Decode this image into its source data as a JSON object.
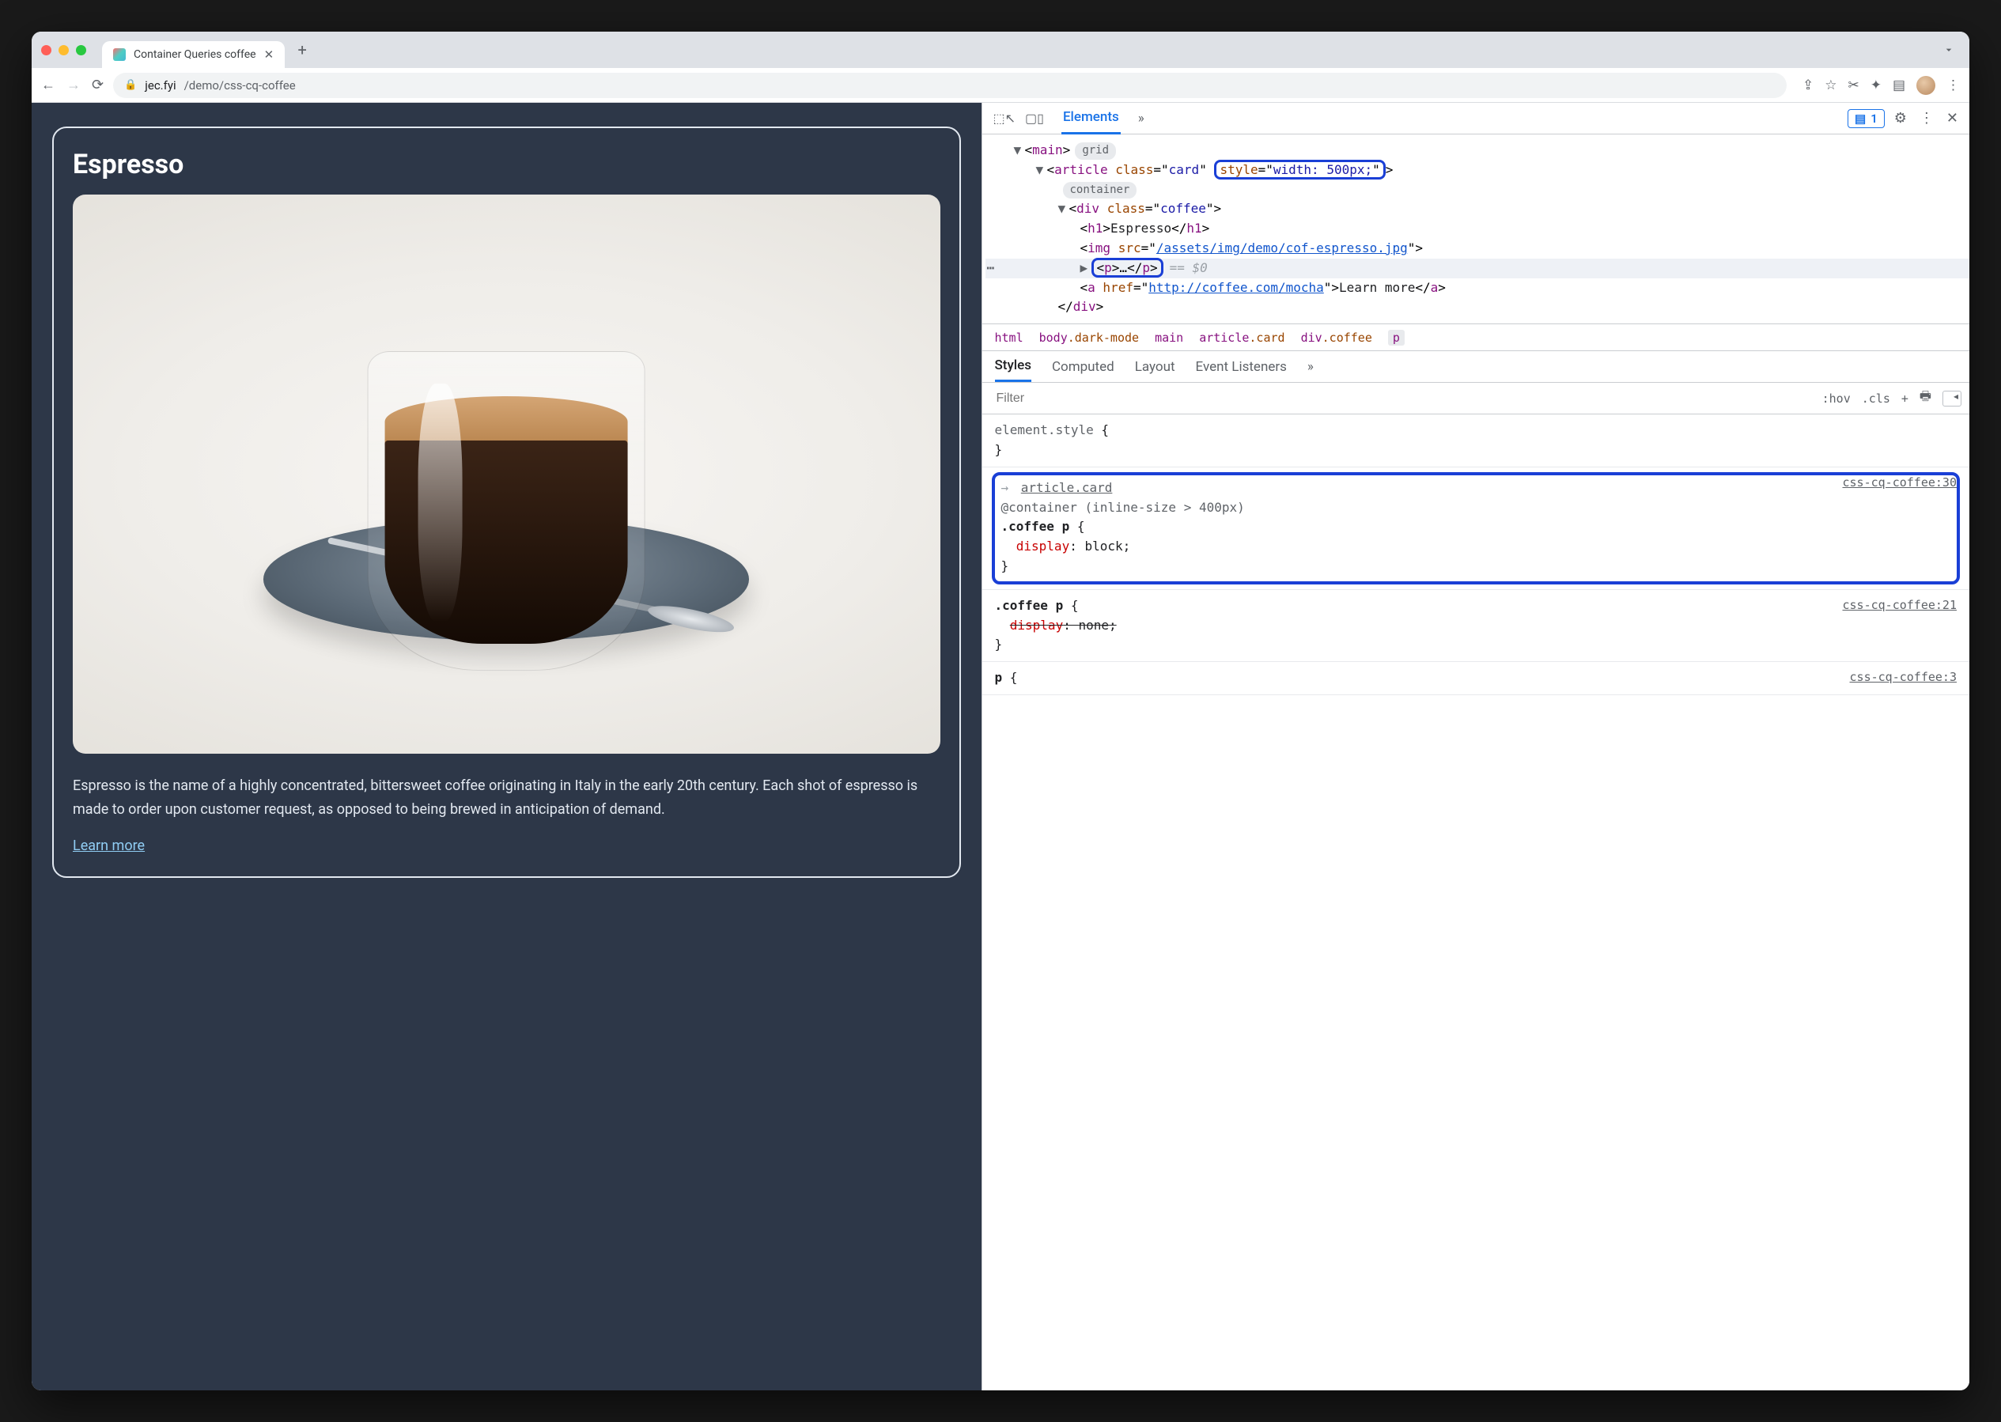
{
  "browser": {
    "tab_title": "Container Queries coffee",
    "url_host": "jec.fyi",
    "url_path": "/demo/css-cq-coffee"
  },
  "page": {
    "heading": "Espresso",
    "paragraph": "Espresso is the name of a highly concentrated, bittersweet coffee originating in Italy in the early 20th century. Each shot of espresso is made to order upon customer request, as opposed to being brewed in anticipation of demand.",
    "link_text": "Learn more"
  },
  "devtools": {
    "top_tabs": {
      "active": "Elements"
    },
    "issue_count": "1",
    "dom": {
      "main_tag": "main",
      "main_pill": "grid",
      "article_open": "article",
      "article_class_attr": "class",
      "article_class_val": "card",
      "article_style_attr": "style",
      "article_style_val": "width: 500px;",
      "article_pill": "container",
      "div_tag": "div",
      "div_class_attr": "class",
      "div_class_val": "coffee",
      "h1_tag": "h1",
      "h1_text": "Espresso",
      "img_tag": "img",
      "img_attr": "src",
      "img_val": "/assets/img/demo/cof-espresso.jpg",
      "p_tag": "p",
      "p_ellipsis": "…",
      "selected_marker": "== $0",
      "a_tag": "a",
      "a_attr": "href",
      "a_val": "http://coffee.com/mocha",
      "a_text": "Learn more",
      "div_close": "div"
    },
    "crumb": {
      "c1": "html",
      "c2a": "body",
      "c2b": ".dark-mode",
      "c3": "main",
      "c4a": "article",
      "c4b": ".card",
      "c5a": "div",
      "c5b": ".coffee",
      "c6": "p"
    },
    "styles_tabs": {
      "t1": "Styles",
      "t2": "Computed",
      "t3": "Layout",
      "t4": "Event Listeners"
    },
    "filter": {
      "placeholder": "Filter",
      "hov": ":hov",
      "cls": ".cls",
      "plus": "+"
    },
    "rules": {
      "r0": {
        "selector": "element.style",
        "open": " {",
        "close": "}"
      },
      "r1": {
        "inherit_prefix": "→ ",
        "inherit": "article.card",
        "at": "@container",
        "cond": " (inline-size > 400px)",
        "selector": ".coffee p",
        "open": " {",
        "prop": "display",
        "val": "block",
        "sep": ": ",
        "end": ";",
        "close": "}",
        "src": "css-cq-coffee:30"
      },
      "r2": {
        "selector": ".coffee p",
        "open": " {",
        "prop": "display",
        "val": "none",
        "sep": ": ",
        "end": ";",
        "close": "}",
        "src": "css-cq-coffee:21"
      },
      "r3": {
        "selector": "p",
        "open": " {",
        "src": "css-cq-coffee:3"
      }
    }
  }
}
